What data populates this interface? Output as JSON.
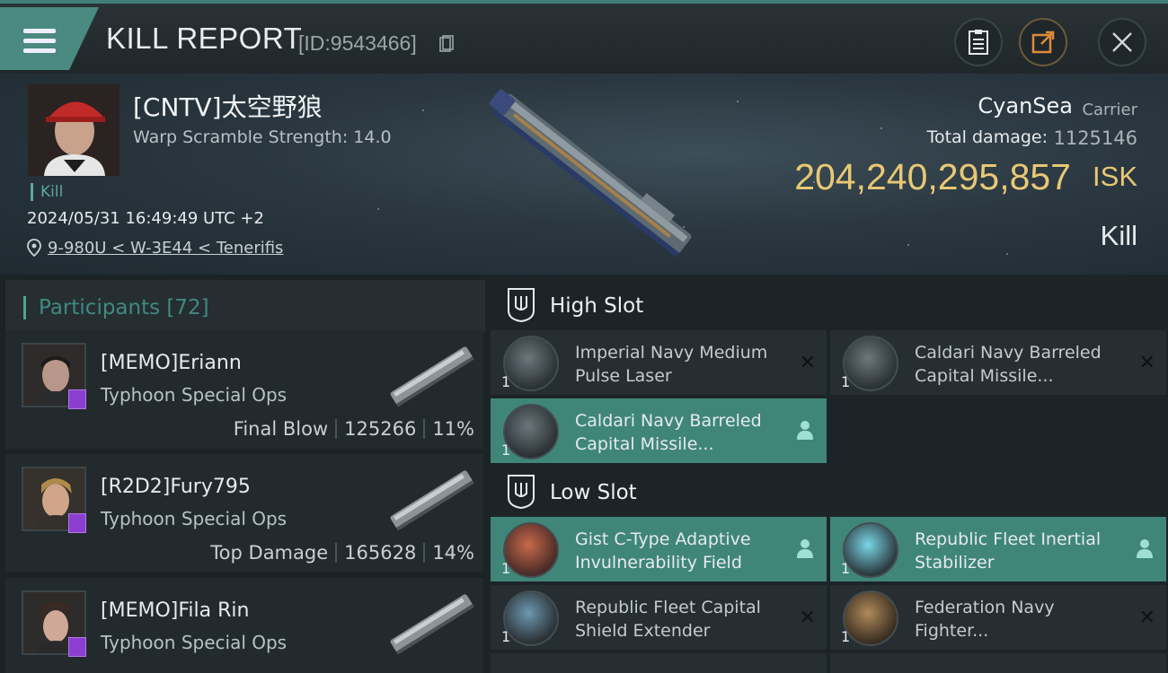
{
  "header": {
    "title": "KILL REPORT",
    "report_id": "[ID:9543466]"
  },
  "victim": {
    "pilot_name": "[CNTV]太空野狼",
    "warp_scramble": "Warp Scramble Strength: 14.0",
    "kill_tag": "Kill",
    "datetime": "2024/05/31 16:49:49 UTC +2",
    "location": "9-980U < W-3E44 < Tenerifis",
    "ship_name": "CyanSea",
    "ship_class": "Carrier",
    "total_damage_label": "Total damage:",
    "total_damage": "1125146",
    "isk_value": "204,240,295,857",
    "isk_unit": "ISK",
    "result": "Kill"
  },
  "participants": {
    "title": "Participants [72]",
    "items": [
      {
        "name": "[MEMO]Eriann",
        "ship": "Typhoon Special Ops",
        "role": "Final Blow",
        "damage": "125266",
        "percent": "11%"
      },
      {
        "name": "[R2D2]Fury795",
        "ship": "Typhoon Special Ops",
        "role": "Top Damage",
        "damage": "165628",
        "percent": "14%"
      },
      {
        "name": "[MEMO]Fila Rin",
        "ship": "Typhoon Special Ops",
        "role": "",
        "damage": "",
        "percent": ""
      }
    ]
  },
  "fitting": {
    "high_slot_label": "High Slot",
    "low_slot_label": "Low Slot",
    "high": [
      {
        "name": "Imperial Navy Medium Pulse Laser",
        "qty": "1",
        "state": "destroyed"
      },
      {
        "name": "Caldari Navy Barreled Capital Missile...",
        "qty": "1",
        "state": "destroyed"
      },
      {
        "name": "Caldari Navy Barreled Capital Missile...",
        "qty": "1",
        "state": "dropped"
      }
    ],
    "low": [
      {
        "name": "Gist C-Type Adaptive Invulnerability Field",
        "qty": "1",
        "state": "dropped"
      },
      {
        "name": "Republic Fleet Inertial Stabilizer",
        "qty": "1",
        "state": "dropped"
      },
      {
        "name": "Republic Fleet Capital Shield Extender",
        "qty": "1",
        "state": "destroyed"
      },
      {
        "name": "Federation Navy Fighter...",
        "qty": "1",
        "state": "destroyed"
      }
    ]
  },
  "colors": {
    "accent": "#3f8679",
    "isk": "#e8c874",
    "badge": "#8b3fd0"
  }
}
